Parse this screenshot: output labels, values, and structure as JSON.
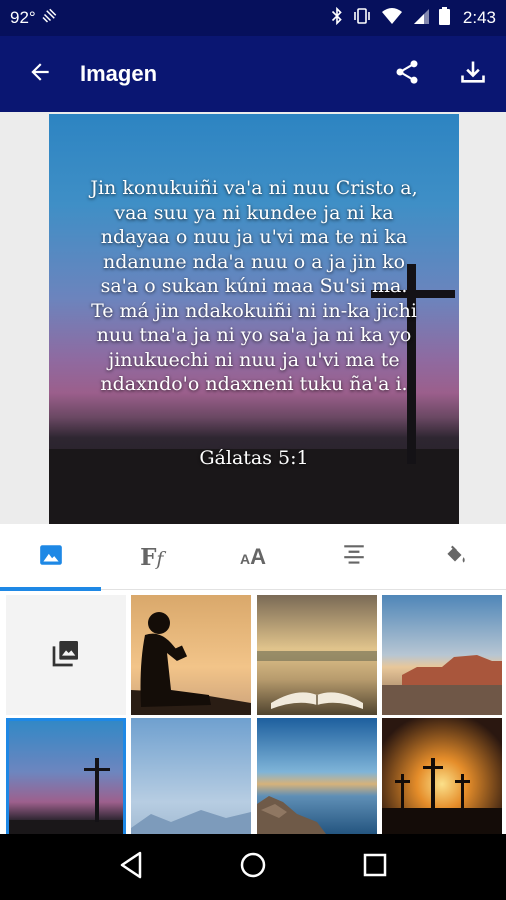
{
  "status_bar": {
    "battery_percent": "92°",
    "time": "2:43"
  },
  "app_bar": {
    "title": "Imagen",
    "back_icon": "arrow-back-icon",
    "share_icon": "share-icon",
    "download_icon": "download-icon"
  },
  "preview": {
    "verse_text": "Jin konukuiñi va'a ni nuu Cristo a, vaa suu ya ni kundee ja ni ka ndayaa o nuu ja u'vi ma te ni ka ndanune nda'a nuu o a ja jin ko sa'a o sukan kúni maa Su'si ma. Te má jin ndakokuiñi ni in-ka jichi nuu tna'a ja ni yo sa'a ja ni ka yo jinukuechi ni nuu ja u'vi ma te ndaxndo'o ndaxneni tuku ña'a i.",
    "reference": "Gálatas 5:1"
  },
  "tabs": [
    {
      "name": "image-tab",
      "icon": "image-icon",
      "active": true
    },
    {
      "name": "font-tab",
      "icon": "font-family-icon",
      "active": false
    },
    {
      "name": "font-size-tab",
      "icon": "text-size-icon",
      "active": false
    },
    {
      "name": "align-tab",
      "icon": "align-center-icon",
      "active": false
    },
    {
      "name": "color-tab",
      "icon": "paint-bucket-icon",
      "active": false
    }
  ],
  "gallery": {
    "pick_icon": "photo-library-icon",
    "selected_index": 4,
    "thumbnails": [
      "person-reading-silhouette",
      "open-bible-sunset",
      "desert-mesa",
      "cross-at-dusk",
      "misty-mountains",
      "rocky-coast-sunrise",
      "three-crosses-sunset"
    ]
  },
  "nav_bar": {
    "back_icon": "nav-back-icon",
    "home_icon": "nav-home-icon",
    "recents_icon": "nav-recents-icon"
  },
  "colors": {
    "status_bar": "#06105c",
    "app_bar": "#0a1672",
    "accent": "#1e88e5"
  }
}
